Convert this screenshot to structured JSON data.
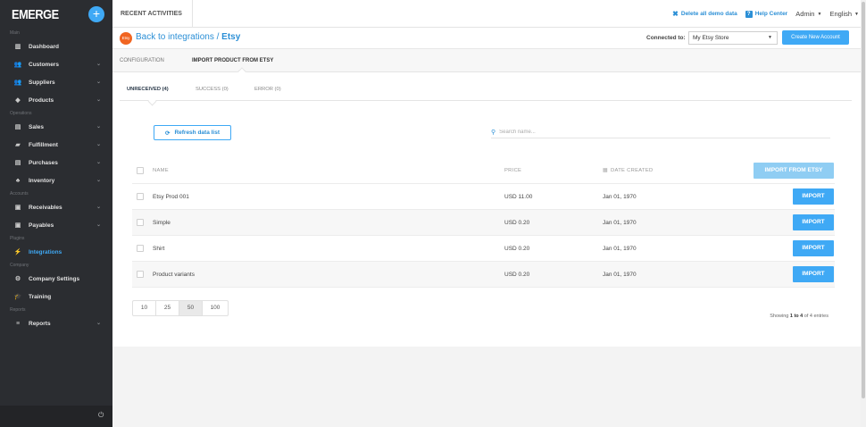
{
  "brand": {
    "logo": "EMERGE",
    "add_label": "+"
  },
  "sidebar": {
    "sections": [
      {
        "label": "Main",
        "items": [
          {
            "label": "Dashboard",
            "icon": "chart-icon",
            "glyph": "▥",
            "chevron": false
          },
          {
            "label": "Customers",
            "icon": "users-icon",
            "glyph": "👥",
            "chevron": true
          },
          {
            "label": "Suppliers",
            "icon": "suppliers-icon",
            "glyph": "👥",
            "chevron": true
          },
          {
            "label": "Products",
            "icon": "tag-icon",
            "glyph": "◆",
            "chevron": true
          }
        ]
      },
      {
        "label": "Operations",
        "items": [
          {
            "label": "Sales",
            "icon": "sales-icon",
            "glyph": "▤",
            "chevron": true
          },
          {
            "label": "Fulfillment",
            "icon": "truck-icon",
            "glyph": "▰",
            "chevron": true
          },
          {
            "label": "Purchases",
            "icon": "purchases-icon",
            "glyph": "▤",
            "chevron": true
          },
          {
            "label": "Inventory",
            "icon": "inventory-icon",
            "glyph": "♣",
            "chevron": true
          }
        ]
      },
      {
        "label": "Accounts",
        "items": [
          {
            "label": "Receivables",
            "icon": "money-icon",
            "glyph": "▣",
            "chevron": true
          },
          {
            "label": "Payables",
            "icon": "money-icon",
            "glyph": "▣",
            "chevron": true
          }
        ]
      },
      {
        "label": "Plugins",
        "items": [
          {
            "label": "Integrations",
            "icon": "integrations-icon",
            "glyph": "⚡",
            "chevron": false,
            "active": true
          }
        ]
      },
      {
        "label": "Company",
        "items": [
          {
            "label": "Company Settings",
            "icon": "gear-icon",
            "glyph": "⚙",
            "chevron": false
          },
          {
            "label": "Training",
            "icon": "graduation-icon",
            "glyph": "🎓",
            "chevron": false
          }
        ]
      },
      {
        "label": "Reports",
        "items": [
          {
            "label": "Reports",
            "icon": "list-icon",
            "glyph": "≡",
            "chevron": true
          }
        ]
      }
    ],
    "power_glyph": "⏻"
  },
  "topbar": {
    "recent": "RECENT ACTIVITIES",
    "delete_demo": "Delete all demo data",
    "help_center": "Help Center",
    "admin": "Admin",
    "language": "English"
  },
  "header": {
    "badge": "Etsy",
    "back": "Back to integrations",
    "separator": "/",
    "current": "Etsy",
    "connected_label": "Connected to:",
    "store": "My Etsy Store",
    "create_account": "Create New Account"
  },
  "subtabs": [
    "CONFIGURATION",
    "IMPORT PRODUCT FROM ETSY"
  ],
  "status_tabs": [
    "UNRECEIVED (4)",
    "SUCCESS (0)",
    "ERROR (0)"
  ],
  "toolbar": {
    "refresh": "Refresh data list",
    "search_placeholder": "Search name..."
  },
  "table": {
    "headers": {
      "name": "NAME",
      "price": "PRICE",
      "date": "DATE CREATED",
      "import_all": "IMPORT FROM ETSY"
    },
    "import_label": "IMPORT",
    "rows": [
      {
        "name": "Etsy Prod 001",
        "price": "USD 11.00",
        "date": "Jan 01, 1970"
      },
      {
        "name": "Simple",
        "price": "USD 0.20",
        "date": "Jan 01, 1970"
      },
      {
        "name": "Shirt",
        "price": "USD 0.20",
        "date": "Jan 01, 1970"
      },
      {
        "name": "Product variants",
        "price": "USD 0.20",
        "date": "Jan 01, 1970"
      }
    ]
  },
  "pager": {
    "sizes": [
      "10",
      "25",
      "50",
      "100"
    ],
    "selected": "50"
  },
  "showing": {
    "prefix": "Showing",
    "range": "1 to 4",
    "suffix": "of 4 entries"
  },
  "colors": {
    "accent": "#3fa9f5",
    "sidebar": "#2b2d31",
    "etsy": "#f16521"
  }
}
